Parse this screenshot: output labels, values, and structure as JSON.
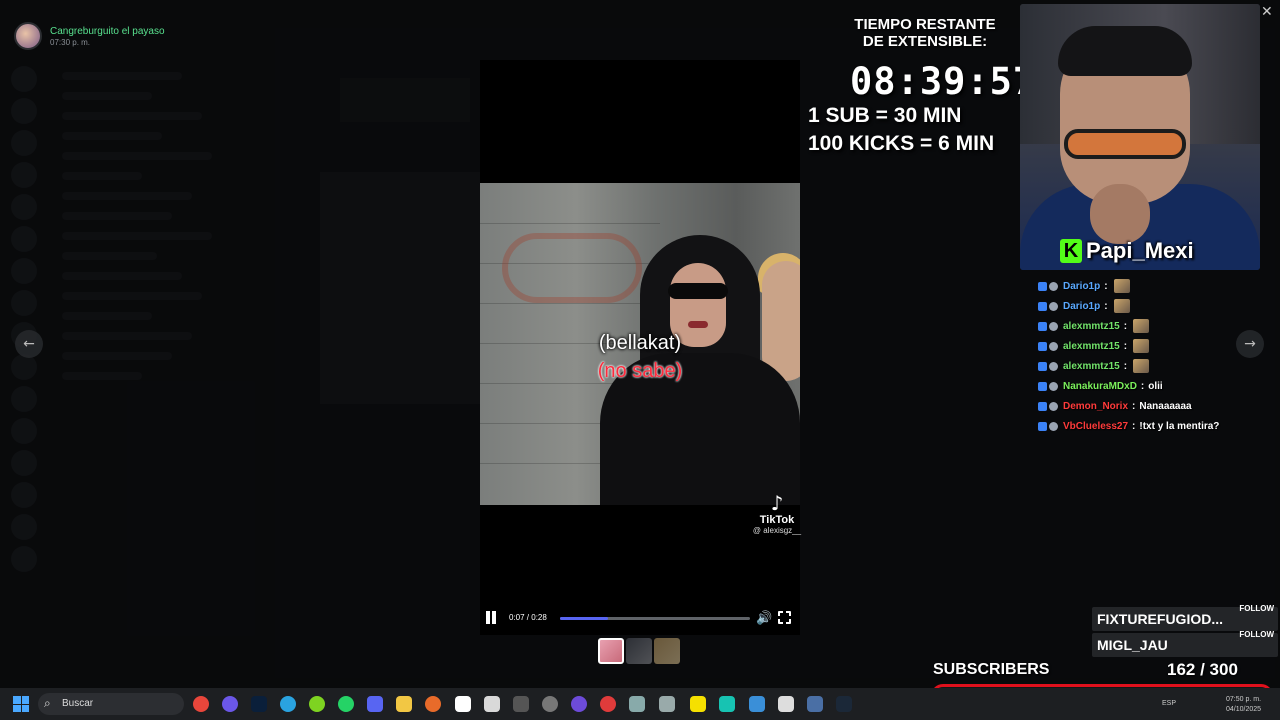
{
  "notification": {
    "name": "Cangreburguito el payaso",
    "time": "07:30 p. m."
  },
  "video": {
    "caption_top": "(bellakat)",
    "caption_bottom": "(no sabe)",
    "watermark_label": "TikTok",
    "watermark_handle": "@ alexisgz__",
    "time_display": "0:07 / 0:28",
    "progress": 0.25,
    "state": "playing"
  },
  "overlay": {
    "timer_title_1": "TIEMPO RESTANTE",
    "timer_title_2": "DE EXTENSIBLE:",
    "timer_value": "08:39:57",
    "rule_1": "1 SUB = 30 MIN",
    "rule_2": "100 KICKS = 6 MIN",
    "streamer_name": "Papi_Mexi",
    "brand_color": "#53fc18"
  },
  "chat": [
    {
      "user": "Dario1p",
      "msg": "",
      "color": "#5aa9ff",
      "emote": true
    },
    {
      "user": "Dario1p",
      "msg": "",
      "color": "#5aa9ff",
      "emote": true
    },
    {
      "user": "alexmmtz15",
      "msg": "",
      "color": "#72e36b",
      "emote": true
    },
    {
      "user": "alexmmtz15",
      "msg": "",
      "color": "#72e36b",
      "emote": true
    },
    {
      "user": "alexmmtz15",
      "msg": "",
      "color": "#72e36b",
      "emote": true
    },
    {
      "user": "NanakuraMDxD",
      "msg": "olii",
      "color": "#7bf05c",
      "emote": false
    },
    {
      "user": "Demon_Norix",
      "msg": "Nanaaaaaa",
      "color": "#ff3b3b",
      "emote": false
    },
    {
      "user": "VbClueless27",
      "msg": "!txt y la mentira?",
      "color": "#ff3b3b",
      "emote": false
    }
  ],
  "followers": [
    {
      "name": "FIXTUREFUGIOD...",
      "tag": "FOLLOW"
    },
    {
      "name": "MIGL_JAU",
      "tag": "FOLLOW"
    }
  ],
  "subscribers": {
    "label": "SUBSCRIBERS",
    "current": 162,
    "goal": 300,
    "count_text": "162  / 300"
  },
  "taskbar": {
    "search_placeholder": "Buscar",
    "lang": "ESP",
    "time": "07:50 p. m.",
    "date": "04/10/2025"
  },
  "icons": {
    "prev": "arrow-left-icon",
    "next": "arrow-right-icon",
    "close": "close-icon",
    "pause": "pause-icon",
    "volume": "volume-icon",
    "fullscreen": "fullscreen-icon"
  }
}
